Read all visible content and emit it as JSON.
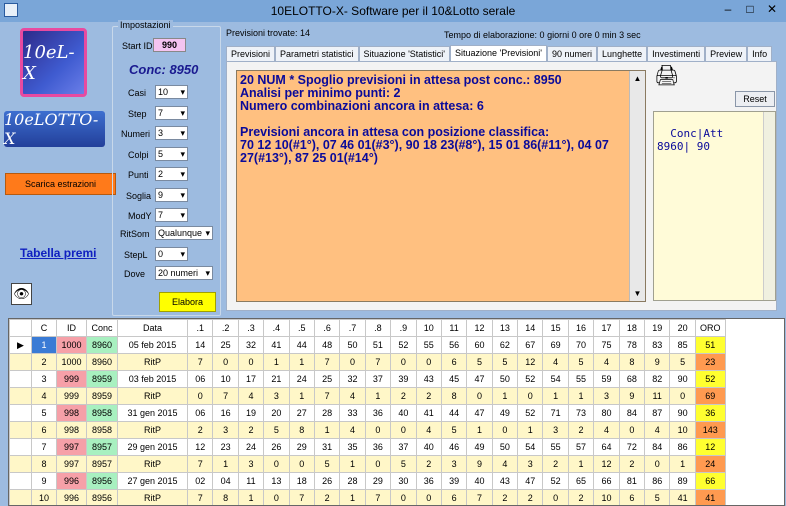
{
  "window": {
    "title": "10ELOTTO-X- Software per il 10&Lotto  serale",
    "minimize": "–",
    "maximize": "□",
    "close": "✕"
  },
  "logos": {
    "top": "10eL-X",
    "bottom": "10eLOTTO-X"
  },
  "left": {
    "scarica": "Scarica estrazioni",
    "tabella": "Tabella premi",
    "eye_icon": "eye-icon"
  },
  "impostazioni": {
    "label": "Impostazioni",
    "start_id_label": "Start ID",
    "start_id": "990",
    "conc": "Conc: 8950",
    "fields": [
      {
        "label": "Casi",
        "value": "10"
      },
      {
        "label": "Step",
        "value": "7"
      },
      {
        "label": "Numeri",
        "value": "3"
      },
      {
        "label": "Colpi",
        "value": "5"
      },
      {
        "label": "Punti",
        "value": "2"
      },
      {
        "label": "Soglia",
        "value": "9"
      },
      {
        "label": "ModY",
        "value": "7"
      },
      {
        "label": "RitSom",
        "value": "Qualunque"
      },
      {
        "label": "StepL",
        "value": "0"
      },
      {
        "label": "Dove",
        "value": "20 numeri"
      }
    ],
    "elabora": "Elabora"
  },
  "status": {
    "previsioni": "Previsioni trovate: 14",
    "tempo": "Tempo di elaborazione: 0 giorni 0 ore 0 min 3 sec"
  },
  "tabs": [
    "Previsioni",
    "Parametri statistici",
    "Situazione 'Statistici'",
    "Situazione 'Previsioni'",
    "90 numeri",
    "Lunghette",
    "Investimenti",
    "Preview",
    "Info"
  ],
  "report": "20 NUM * Spoglio previsioni in attesa post conc.: 8950\nAnalisi per minimo punti: 2\nNumero combinazioni ancora in attesa: 6\n\nPrevisioni ancora in attesa con posizione classifica:\n70 12 10(#1°), 07 46 01(#3°), 90 18 23(#8°), 15 01 86(#11°), 04 07 27(#13°), 87 25 01(#14°)",
  "side": {
    "reset": "Reset",
    "printer_icon": "printer-icon",
    "concatt": "Conc|Att\n8960| 90"
  },
  "grid": {
    "headers": [
      "",
      "C",
      "ID",
      "Conc",
      "Data",
      ".1",
      ".2",
      ".3",
      ".4",
      ".5",
      ".6",
      ".7",
      ".8",
      ".9",
      "10",
      "11",
      "12",
      "13",
      "14",
      "15",
      "16",
      "17",
      "18",
      "19",
      "20",
      "ORO"
    ],
    "rows": [
      {
        "c": "1",
        "id": "1000",
        "conc": "8960",
        "data": "05 feb 2015",
        "vals": [
          "14",
          "25",
          "32",
          "41",
          "44",
          "48",
          "50",
          "51",
          "52",
          "55",
          "56",
          "60",
          "62",
          "67",
          "69",
          "70",
          "75",
          "78",
          "83",
          "85"
        ],
        "oro": "51",
        "oroc": "y",
        "sel": true
      },
      {
        "c": "2",
        "id": "1000",
        "conc": "8960",
        "data": "RitP",
        "vals": [
          "7",
          "0",
          "0",
          "1",
          "1",
          "7",
          "0",
          "7",
          "0",
          "0",
          "6",
          "5",
          "5",
          "12",
          "4",
          "5",
          "4",
          "8",
          "9",
          "5"
        ],
        "oro": "23",
        "oroc": "o",
        "alt": true
      },
      {
        "c": "3",
        "id": "999",
        "conc": "8959",
        "data": "03 feb 2015",
        "vals": [
          "06",
          "10",
          "17",
          "21",
          "24",
          "25",
          "32",
          "37",
          "39",
          "43",
          "45",
          "47",
          "50",
          "52",
          "54",
          "55",
          "59",
          "68",
          "82",
          "90"
        ],
        "oro": "52",
        "oroc": "y"
      },
      {
        "c": "4",
        "id": "999",
        "conc": "8959",
        "data": "RitP",
        "vals": [
          "0",
          "7",
          "4",
          "3",
          "1",
          "7",
          "4",
          "1",
          "2",
          "2",
          "8",
          "0",
          "1",
          "0",
          "1",
          "1",
          "3",
          "9",
          "11",
          "0"
        ],
        "oro": "69",
        "oroc": "o",
        "alt": true
      },
      {
        "c": "5",
        "id": "998",
        "conc": "8958",
        "data": "31 gen 2015",
        "vals": [
          "06",
          "16",
          "19",
          "20",
          "27",
          "28",
          "33",
          "36",
          "40",
          "41",
          "44",
          "47",
          "49",
          "52",
          "71",
          "73",
          "80",
          "84",
          "87",
          "90"
        ],
        "oro": "36",
        "oroc": "y"
      },
      {
        "c": "6",
        "id": "998",
        "conc": "8958",
        "data": "RitP",
        "vals": [
          "2",
          "3",
          "2",
          "5",
          "8",
          "1",
          "4",
          "0",
          "0",
          "4",
          "5",
          "1",
          "0",
          "1",
          "3",
          "2",
          "4",
          "0",
          "4",
          "10"
        ],
        "oro": "143",
        "oroc": "o",
        "alt": true
      },
      {
        "c": "7",
        "id": "997",
        "conc": "8957",
        "data": "29 gen 2015",
        "vals": [
          "12",
          "23",
          "24",
          "26",
          "29",
          "31",
          "35",
          "36",
          "37",
          "40",
          "46",
          "49",
          "50",
          "54",
          "55",
          "57",
          "64",
          "72",
          "84",
          "86"
        ],
        "oro": "12",
        "oroc": "y"
      },
      {
        "c": "8",
        "id": "997",
        "conc": "8957",
        "data": "RitP",
        "vals": [
          "7",
          "1",
          "3",
          "0",
          "0",
          "5",
          "1",
          "0",
          "5",
          "2",
          "3",
          "9",
          "4",
          "3",
          "2",
          "1",
          "12",
          "2",
          "0",
          "1"
        ],
        "oro": "24",
        "oroc": "o",
        "alt": true
      },
      {
        "c": "9",
        "id": "996",
        "conc": "8956",
        "data": "27 gen 2015",
        "vals": [
          "02",
          "04",
          "11",
          "13",
          "18",
          "26",
          "28",
          "29",
          "30",
          "36",
          "39",
          "40",
          "43",
          "47",
          "52",
          "65",
          "66",
          "81",
          "86",
          "89"
        ],
        "oro": "66",
        "oroc": "y"
      },
      {
        "c": "10",
        "id": "996",
        "conc": "8956",
        "data": "RitP",
        "vals": [
          "7",
          "8",
          "1",
          "0",
          "7",
          "2",
          "1",
          "7",
          "0",
          "0",
          "6",
          "7",
          "2",
          "2",
          "0",
          "2",
          "10",
          "6",
          "5",
          "41"
        ],
        "oro": "41",
        "oroc": "o",
        "alt": true
      }
    ]
  }
}
